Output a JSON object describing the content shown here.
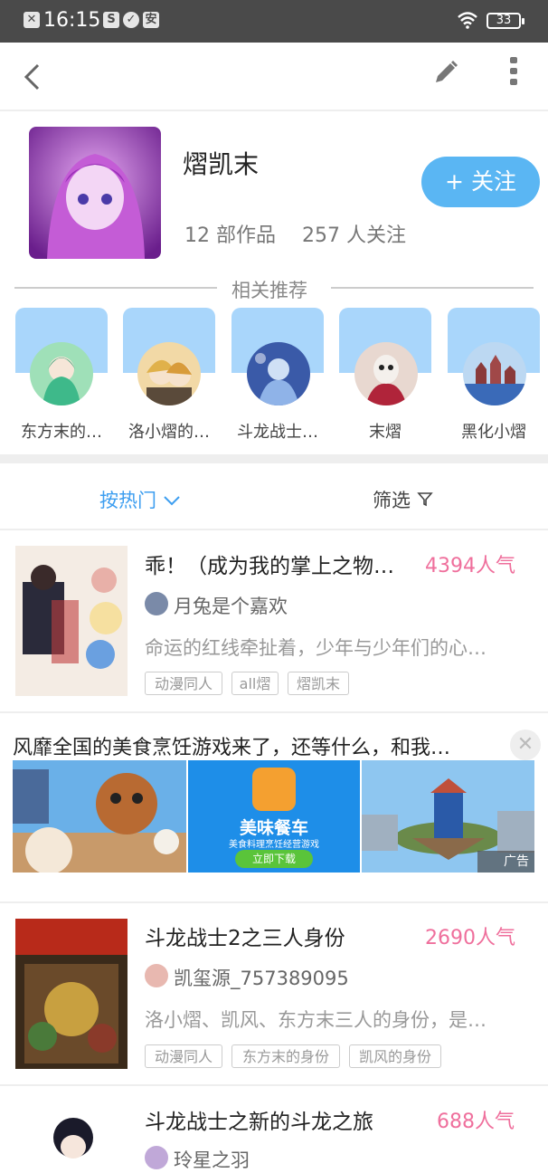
{
  "statusbar": {
    "time": "16:15",
    "battery": "33"
  },
  "profile": {
    "name": "熠凯末",
    "follow_label": "+ 关注",
    "works": "12 部作品",
    "followers": "257 人关注"
  },
  "recommend": {
    "title": "相关推荐",
    "items": [
      {
        "name": "东方末的…"
      },
      {
        "name": "洛小熠的…"
      },
      {
        "name": "斗龙战士…"
      },
      {
        "name": "末熠"
      },
      {
        "name": "黑化小熠"
      }
    ]
  },
  "sort_label": "按热门",
  "filter_label": "筛选",
  "works": [
    {
      "title": "乖！（成为我的掌上之物…",
      "popularity": "4394人气",
      "author": "月兔是个嘉欢",
      "desc": "命运的红线牵扯着，少年与少年们的心…",
      "tags": [
        "动漫同人",
        "all熠",
        "熠凯末"
      ]
    },
    {
      "title": "斗龙战士2之三人身份",
      "popularity": "2690人气",
      "author": "凯玺源_757389095",
      "desc": "洛小熠、凯风、东方末三人的身份，是…",
      "tags": [
        "动漫同人",
        "东方末的身份",
        "凯风的身份"
      ]
    },
    {
      "title": "斗龙战士之新的斗龙之旅",
      "popularity": "688人气",
      "author": "玲星之羽",
      "desc": "",
      "tags": []
    }
  ],
  "ad": {
    "text": "风靡全国的美食烹饪游戏来了，还等什么，和我…",
    "game_name": "美味餐车",
    "game_sub": "美食料理烹饪经营游戏",
    "download": "立即下载",
    "ad_label": "广告"
  }
}
